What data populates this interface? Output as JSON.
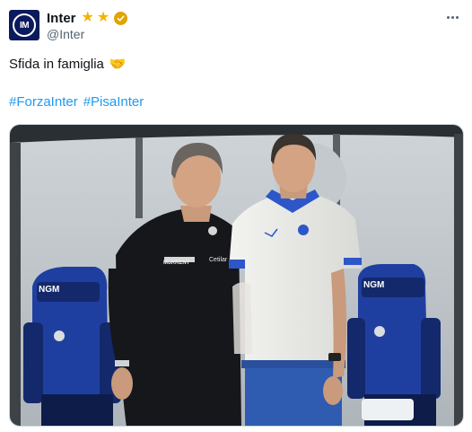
{
  "account": {
    "display_name": "Inter",
    "handle": "@Inter",
    "avatar_text": "IM",
    "badge_icons": [
      "star-icon",
      "star-icon",
      "verified-badge-icon"
    ]
  },
  "tweet": {
    "text": "Sfida in famiglia",
    "emoji": "🤝",
    "hashtags": [
      "#ForzaInter",
      "#PisaInter"
    ]
  },
  "photo": {
    "seat_brand_left": "NGM",
    "seat_brand_right": "NGM",
    "sponsor_left": "MuRRENT",
    "sponsor_right": "Cetilar"
  },
  "colors": {
    "hashtag": "#1d9bf0",
    "star": "#f5b300",
    "inter_navy": "#0a1a5c",
    "seat_blue": "#1f3fa0"
  }
}
